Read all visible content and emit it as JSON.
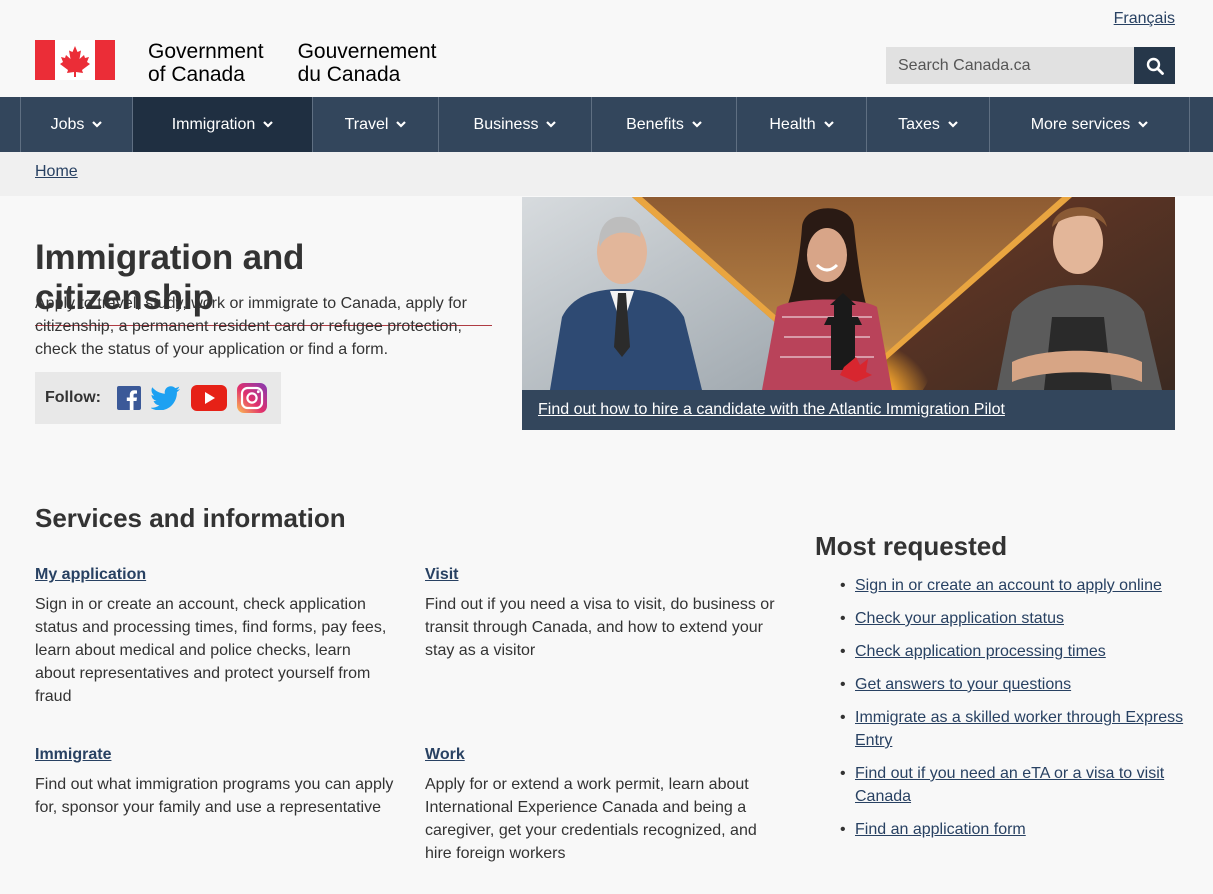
{
  "header": {
    "language_link": "Français",
    "brand_en_line1": "Government",
    "brand_en_line2": "of Canada",
    "brand_fr_line1": "Gouvernement",
    "brand_fr_line2": "du Canada",
    "search_placeholder": "Search Canada.ca",
    "search_icon": "magnifier-icon",
    "flag_color": "#eb2d37"
  },
  "menu": {
    "items": [
      {
        "label": "Jobs"
      },
      {
        "label": "Immigration"
      },
      {
        "label": "Travel"
      },
      {
        "label": "Business"
      },
      {
        "label": "Benefits"
      },
      {
        "label": "Health"
      },
      {
        "label": "Taxes"
      },
      {
        "label": "More services"
      }
    ],
    "active": "Immigration",
    "bar_color": "#33465c",
    "active_color": "#1f2f41"
  },
  "breadcrumb": {
    "home": "Home"
  },
  "intro": {
    "title": "Immigration and citizenship",
    "text": "Apply to travel, study, work or immigrate to Canada, apply for citizenship, a permanent resident card or refugee protection, check the status of your application or find a form.",
    "follow_label": "Follow:",
    "social_icons": [
      "facebook-icon",
      "twitter-icon",
      "youtube-icon",
      "instagram-icon"
    ]
  },
  "promo": {
    "caption": "Find out how to hire a candidate with the Atlantic Immigration Pilot"
  },
  "services": {
    "heading": "Services and information",
    "items": [
      {
        "title": "My application",
        "desc": "Sign in or create an account, check application status and processing times, find forms, pay fees, learn about medical and police checks, learn about representatives and protect yourself from fraud"
      },
      {
        "title": "Visit",
        "desc": "Find out if you need a visa to visit, do business or transit through Canada, and how to extend your stay as a visitor"
      },
      {
        "title": "Immigrate",
        "desc": "Find out what immigration programs you can apply for, sponsor your family and use a representative"
      },
      {
        "title": "Work",
        "desc": "Apply for or extend a work permit, learn about International Experience Canada and being a caregiver, get your credentials recognized, and hire foreign workers"
      }
    ]
  },
  "most_requested": {
    "heading": "Most requested",
    "items": [
      {
        "label": "Sign in or create an account to apply online"
      },
      {
        "label": "Check your application status"
      },
      {
        "label": "Check application processing times"
      },
      {
        "label": "Get answers to your questions"
      },
      {
        "label": "Immigrate as a skilled worker through Express Entry"
      },
      {
        "label": "Find out if you need an eTA or a visa to visit Canada"
      },
      {
        "label": "Find an application form"
      }
    ]
  }
}
